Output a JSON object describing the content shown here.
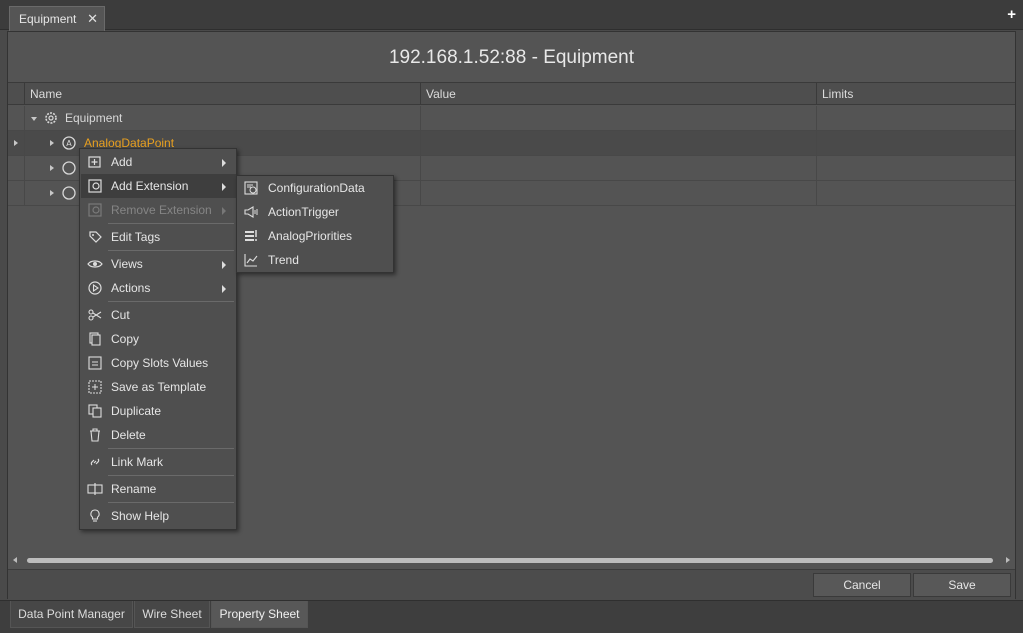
{
  "tab": {
    "title": "Equipment",
    "close_glyph": "✕",
    "add_glyph": "+"
  },
  "panel": {
    "title": "192.168.1.52:88 - Equipment"
  },
  "grid": {
    "columns": [
      "Name",
      "Value",
      "Limits"
    ],
    "rows": [
      {
        "label": "Equipment",
        "icon": "gear-icon",
        "expanded": true
      },
      {
        "label": "AnalogDataPoint",
        "icon": "analog-point-icon",
        "selected": true,
        "color": "#e8a020"
      },
      {
        "label": "",
        "icon": "data-point-icon"
      },
      {
        "label": "",
        "icon": "data-point-icon"
      }
    ]
  },
  "context_menu": {
    "items": [
      {
        "label": "Add",
        "icon": "add-icon",
        "submenu": true
      },
      {
        "label": "Add Extension",
        "icon": "extension-icon",
        "submenu": true,
        "highlighted": true
      },
      {
        "label": "Remove Extension",
        "icon": "remove-extension-icon",
        "submenu": true,
        "disabled": true
      },
      {
        "label": "Edit Tags",
        "icon": "tag-icon"
      },
      {
        "label": "Views",
        "icon": "eye-icon",
        "submenu": true
      },
      {
        "label": "Actions",
        "icon": "play-icon",
        "submenu": true
      },
      {
        "label": "Cut",
        "icon": "scissors-icon"
      },
      {
        "label": "Copy",
        "icon": "copy-icon"
      },
      {
        "label": "Copy Slots Values",
        "icon": "copy-values-icon"
      },
      {
        "label": "Save as Template",
        "icon": "template-icon"
      },
      {
        "label": "Duplicate",
        "icon": "duplicate-icon"
      },
      {
        "label": "Delete",
        "icon": "trash-icon"
      },
      {
        "label": "Link Mark",
        "icon": "link-icon"
      },
      {
        "label": "Rename",
        "icon": "rename-icon"
      },
      {
        "label": "Show Help",
        "icon": "lightbulb-icon"
      }
    ]
  },
  "extension_submenu": {
    "items": [
      {
        "label": "ConfigurationData",
        "icon": "config-data-icon"
      },
      {
        "label": "ActionTrigger",
        "icon": "megaphone-icon"
      },
      {
        "label": "AnalogPriorities",
        "icon": "priorities-icon"
      },
      {
        "label": "Trend",
        "icon": "trend-icon"
      }
    ]
  },
  "buttons": {
    "cancel": "Cancel",
    "save": "Save"
  },
  "bottom_tabs": [
    {
      "label": "Data Point Manager"
    },
    {
      "label": "Wire Sheet"
    },
    {
      "label": "Property Sheet",
      "active": true
    }
  ],
  "colors": {
    "background": "#545454",
    "selected_text": "#e8a020",
    "menu_bg": "#4f4f4f",
    "menu_highlight": "#3e3e3e"
  }
}
